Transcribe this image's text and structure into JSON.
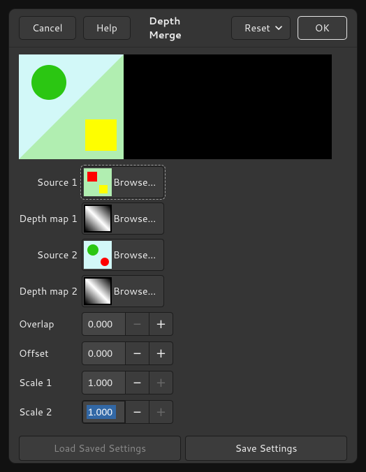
{
  "titlebar": {
    "cancel": "Cancel",
    "help": "Help",
    "title": "Depth Merge",
    "reset": "Reset",
    "ok": "OK"
  },
  "rows": {
    "source1_label": "Source 1",
    "depthmap1_label": "Depth map 1",
    "source2_label": "Source 2",
    "depthmap2_label": "Depth map 2",
    "browse": "Browse..."
  },
  "params": {
    "overlap_label": "Overlap",
    "overlap_value": "0.000",
    "offset_label": "Offset",
    "offset_value": "0.000",
    "scale1_label": "Scale 1",
    "scale1_value": "1.000",
    "scale2_label": "Scale 2",
    "scale2_value": "1.000"
  },
  "footer": {
    "load": "Load Saved Settings",
    "save": "Save Settings"
  },
  "colors": {
    "bg_light": "#d2f8e3",
    "bg_cyan": "#d2f8f8",
    "green": "#2bc612",
    "yellow": "#fefe00",
    "red": "#fe0000"
  }
}
